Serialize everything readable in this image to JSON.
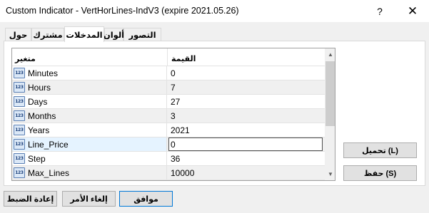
{
  "window": {
    "title": "Custom Indicator - VertHorLines-IndV3 (expire 2021.05.26)",
    "help_label": "?",
    "close_label": "✕"
  },
  "tabs": [
    {
      "label": "حول"
    },
    {
      "label": "مشترك"
    },
    {
      "label": "المدخلات",
      "active": true
    },
    {
      "label": "ألوان"
    },
    {
      "label": "التصور"
    }
  ],
  "grid": {
    "header_name": "متغير",
    "header_value": "القيمة",
    "icon_text": "123",
    "rows": [
      {
        "name": "Minutes",
        "value": "0"
      },
      {
        "name": "Hours",
        "value": "7"
      },
      {
        "name": "Days",
        "value": "27"
      },
      {
        "name": "Months",
        "value": "3"
      },
      {
        "name": "Years",
        "value": "2021"
      },
      {
        "name": "Line_Price",
        "value": "0"
      },
      {
        "name": "Step",
        "value": "36"
      },
      {
        "name": "Max_Lines",
        "value": "10000"
      }
    ]
  },
  "buttons": {
    "load": "تحميل (L)",
    "save": "حفظ (S)",
    "reset": "إعادة الضبط",
    "cancel": "إلغاء الأمر",
    "ok": "موافق"
  },
  "colors": {
    "accent_border": "#0078d7",
    "selected_row": "#e5f3ff"
  }
}
